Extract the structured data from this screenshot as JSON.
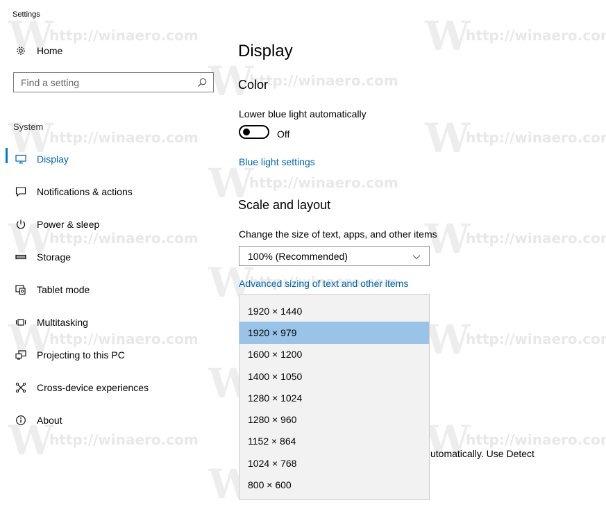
{
  "window": {
    "title": "Settings"
  },
  "watermark_text": "http://winaero.com",
  "watermark_letter": "W",
  "sidebar": {
    "home": {
      "label": "Home",
      "icon": "gear-icon"
    },
    "search": {
      "placeholder": "Find a setting",
      "icon": "search-icon"
    },
    "section_label": "System",
    "items": [
      {
        "label": "Display",
        "icon": "display-icon",
        "active": true
      },
      {
        "label": "Notifications & actions",
        "icon": "notifications-icon"
      },
      {
        "label": "Power & sleep",
        "icon": "power-icon"
      },
      {
        "label": "Storage",
        "icon": "storage-icon"
      },
      {
        "label": "Tablet mode",
        "icon": "tablet-mode-icon"
      },
      {
        "label": "Multitasking",
        "icon": "multitasking-icon"
      },
      {
        "label": "Projecting to this PC",
        "icon": "projecting-icon"
      },
      {
        "label": "Cross-device experiences",
        "icon": "cross-device-icon"
      },
      {
        "label": "About",
        "icon": "info-icon"
      }
    ]
  },
  "main": {
    "title": "Display",
    "color": {
      "heading": "Color",
      "lower_blue_label": "Lower blue light automatically",
      "toggle_state": "Off",
      "link": "Blue light settings"
    },
    "scale": {
      "heading": "Scale and layout",
      "size_label": "Change the size of text, apps, and other items",
      "size_value": "100% (Recommended)",
      "advanced_link": "Advanced sizing of text and other items"
    },
    "partial_text": "utomatically. Use Detect"
  },
  "resolution_dropdown": {
    "selected_index": 1,
    "options": [
      "1920 × 1440",
      "1920 × 979",
      "1600 × 1200",
      "1400 × 1050",
      "1280 × 1024",
      "1280 × 960",
      "1152 × 864",
      "1024 × 768",
      "800 × 600"
    ]
  },
  "colors": {
    "accent": "#0078d7",
    "link": "#0063b1",
    "selected_row": "#99c4e8",
    "dropdown_bg": "#f2f2f2"
  }
}
